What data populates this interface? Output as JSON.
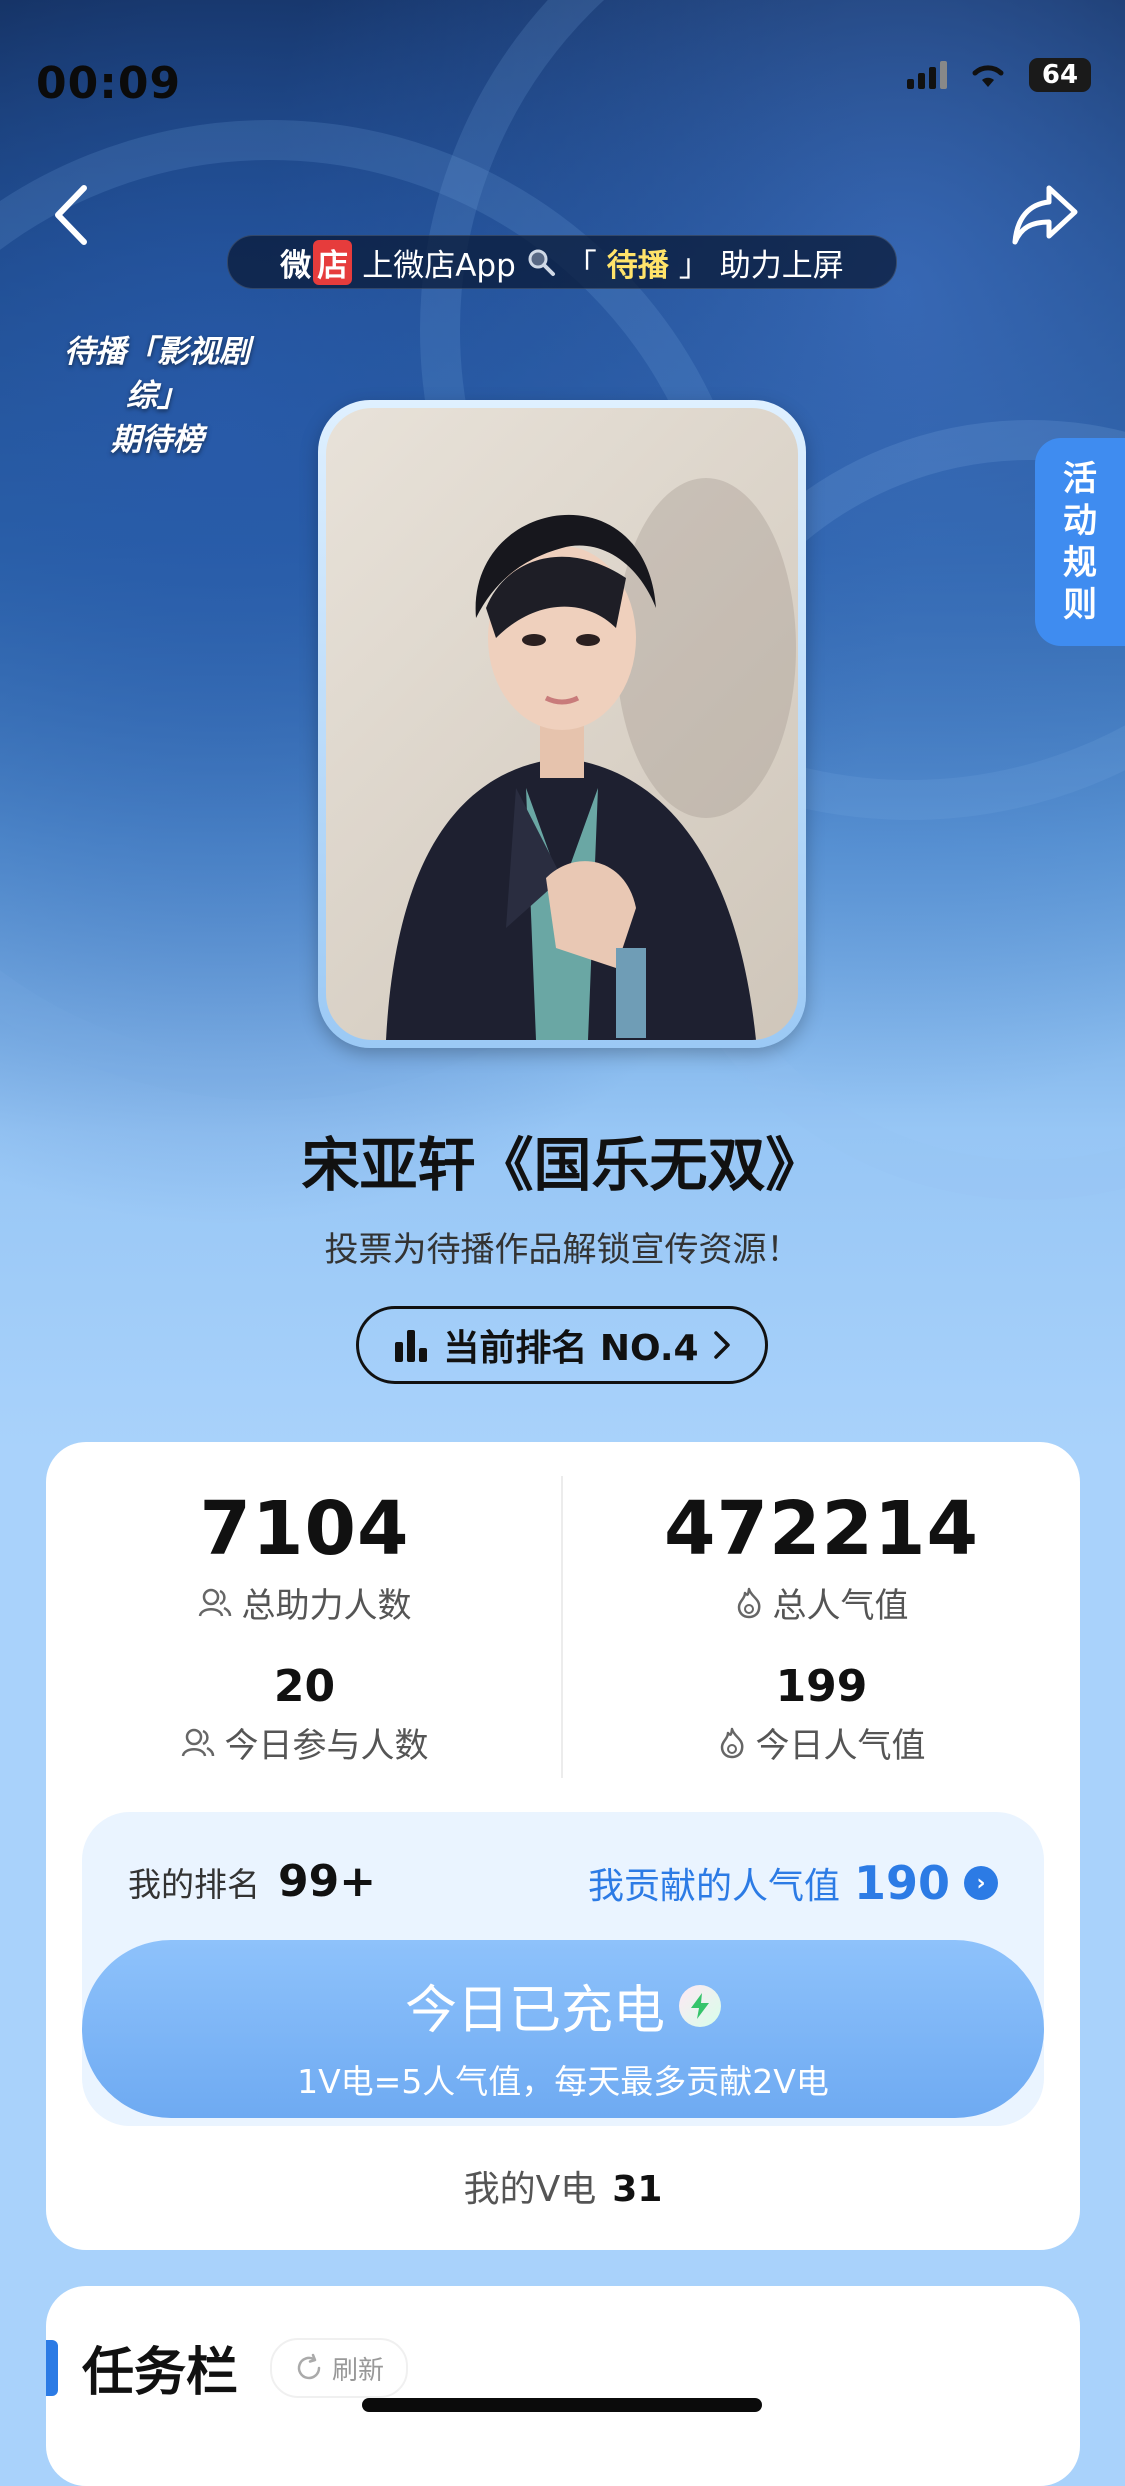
{
  "status": {
    "time": "00:09",
    "battery": "64"
  },
  "promo": {
    "brand_a": "微",
    "brand_b": "店",
    "text": "上微店App",
    "quote_open": "「",
    "highlight": "待播",
    "quote_close": "」",
    "suffix": "助力上屏"
  },
  "corner": {
    "line1": "待播「影视剧综」",
    "line2": "期待榜"
  },
  "rules_tab": {
    "c1": "活",
    "c2": "动",
    "c3": "规",
    "c4": "则"
  },
  "main": {
    "title": "宋亚轩《国乐无双》",
    "subtitle": "投票为待播作品解锁宣传资源！",
    "rank_label": "当前排名 NO.4"
  },
  "stats": {
    "total_helpers": "7104",
    "total_helpers_label": "总助力人数",
    "today_participants": "20",
    "today_participants_label": "今日参与人数",
    "total_popularity": "472214",
    "total_popularity_label": "总人气值",
    "today_popularity": "199",
    "today_popularity_label": "今日人气值"
  },
  "my": {
    "rank_label": "我的排名",
    "rank_value": "99+",
    "contrib_label": "我贡献的人气值",
    "contrib_value": "190",
    "charge_title": "今日已充电",
    "charge_sub": "1V电=5人气值，每天最多贡献2V电",
    "v_label": "我的V电",
    "v_value": "31"
  },
  "tasks": {
    "title": "任务栏",
    "refresh": "刷新"
  },
  "colors": {
    "accent": "#2c7be5",
    "button": "#7ab3f6",
    "rules_tab": "#3f8cf0"
  }
}
